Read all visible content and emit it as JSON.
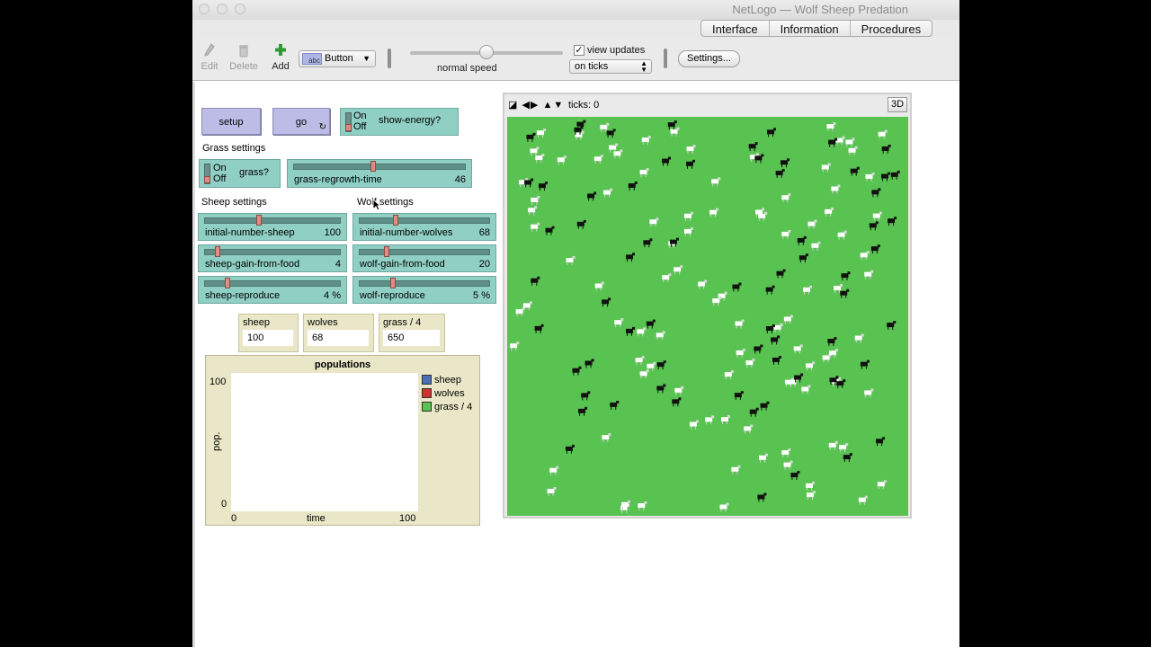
{
  "window": {
    "title": "NetLogo — Wolf Sheep Predation"
  },
  "tabs": [
    {
      "label": "Interface"
    },
    {
      "label": "Information"
    },
    {
      "label": "Procedures"
    }
  ],
  "toolbar": {
    "edit_label": "Edit",
    "delete_label": "Delete",
    "add_label": "Add",
    "widget_type": "Button",
    "widget_icon_text": "abc",
    "speed_label": "normal speed",
    "speed_value": 0.5,
    "view_updates_label": "view updates",
    "view_updates_checked": "✓",
    "update_mode": "on ticks",
    "settings_label": "Settings..."
  },
  "buttons": {
    "setup": "setup",
    "go": "go"
  },
  "switches": {
    "show_energy": {
      "label": "show-energy?",
      "on": "On",
      "off": "Off"
    },
    "grass": {
      "label": "grass?",
      "on": "On",
      "off": "Off"
    }
  },
  "notes": {
    "grass_settings": "Grass settings",
    "sheep_settings": "Sheep settings",
    "wolf_settings": "Wolf settings"
  },
  "sliders": {
    "grass_regrowth_time": {
      "label": "grass-regrowth-time",
      "value": "46",
      "fraction": 0.46
    },
    "initial_number_sheep": {
      "label": "initial-number-sheep",
      "value": "100",
      "fraction": 0.4
    },
    "sheep_gain_from_food": {
      "label": "sheep-gain-from-food",
      "value": "4",
      "fraction": 0.08
    },
    "sheep_reproduce": {
      "label": "sheep-reproduce",
      "value": "4 %",
      "fraction": 0.16
    },
    "initial_number_wolves": {
      "label": "initial-number-wolves",
      "value": "68",
      "fraction": 0.27
    },
    "wolf_gain_from_food": {
      "label": "wolf-gain-from-food",
      "value": "20",
      "fraction": 0.2
    },
    "wolf_reproduce": {
      "label": "wolf-reproduce",
      "value": "5 %",
      "fraction": 0.25
    }
  },
  "monitors": [
    {
      "label": "sheep",
      "value": "100"
    },
    {
      "label": "wolves",
      "value": "68"
    },
    {
      "label": "grass / 4",
      "value": "650"
    }
  ],
  "plot": {
    "title": "populations",
    "ylabel": "pop.",
    "xlabel": "time",
    "y_max": "100",
    "y_min": "0",
    "x_min": "0",
    "x_max": "100",
    "legend": [
      {
        "name": "sheep",
        "color": "#4a6fb5"
      },
      {
        "name": "wolves",
        "color": "#d0312d"
      },
      {
        "name": "grass / 4",
        "color": "#59c351"
      }
    ]
  },
  "view": {
    "ticks_label": "ticks: 0",
    "three_d_label": "3D",
    "patch_color": "#59c351"
  }
}
